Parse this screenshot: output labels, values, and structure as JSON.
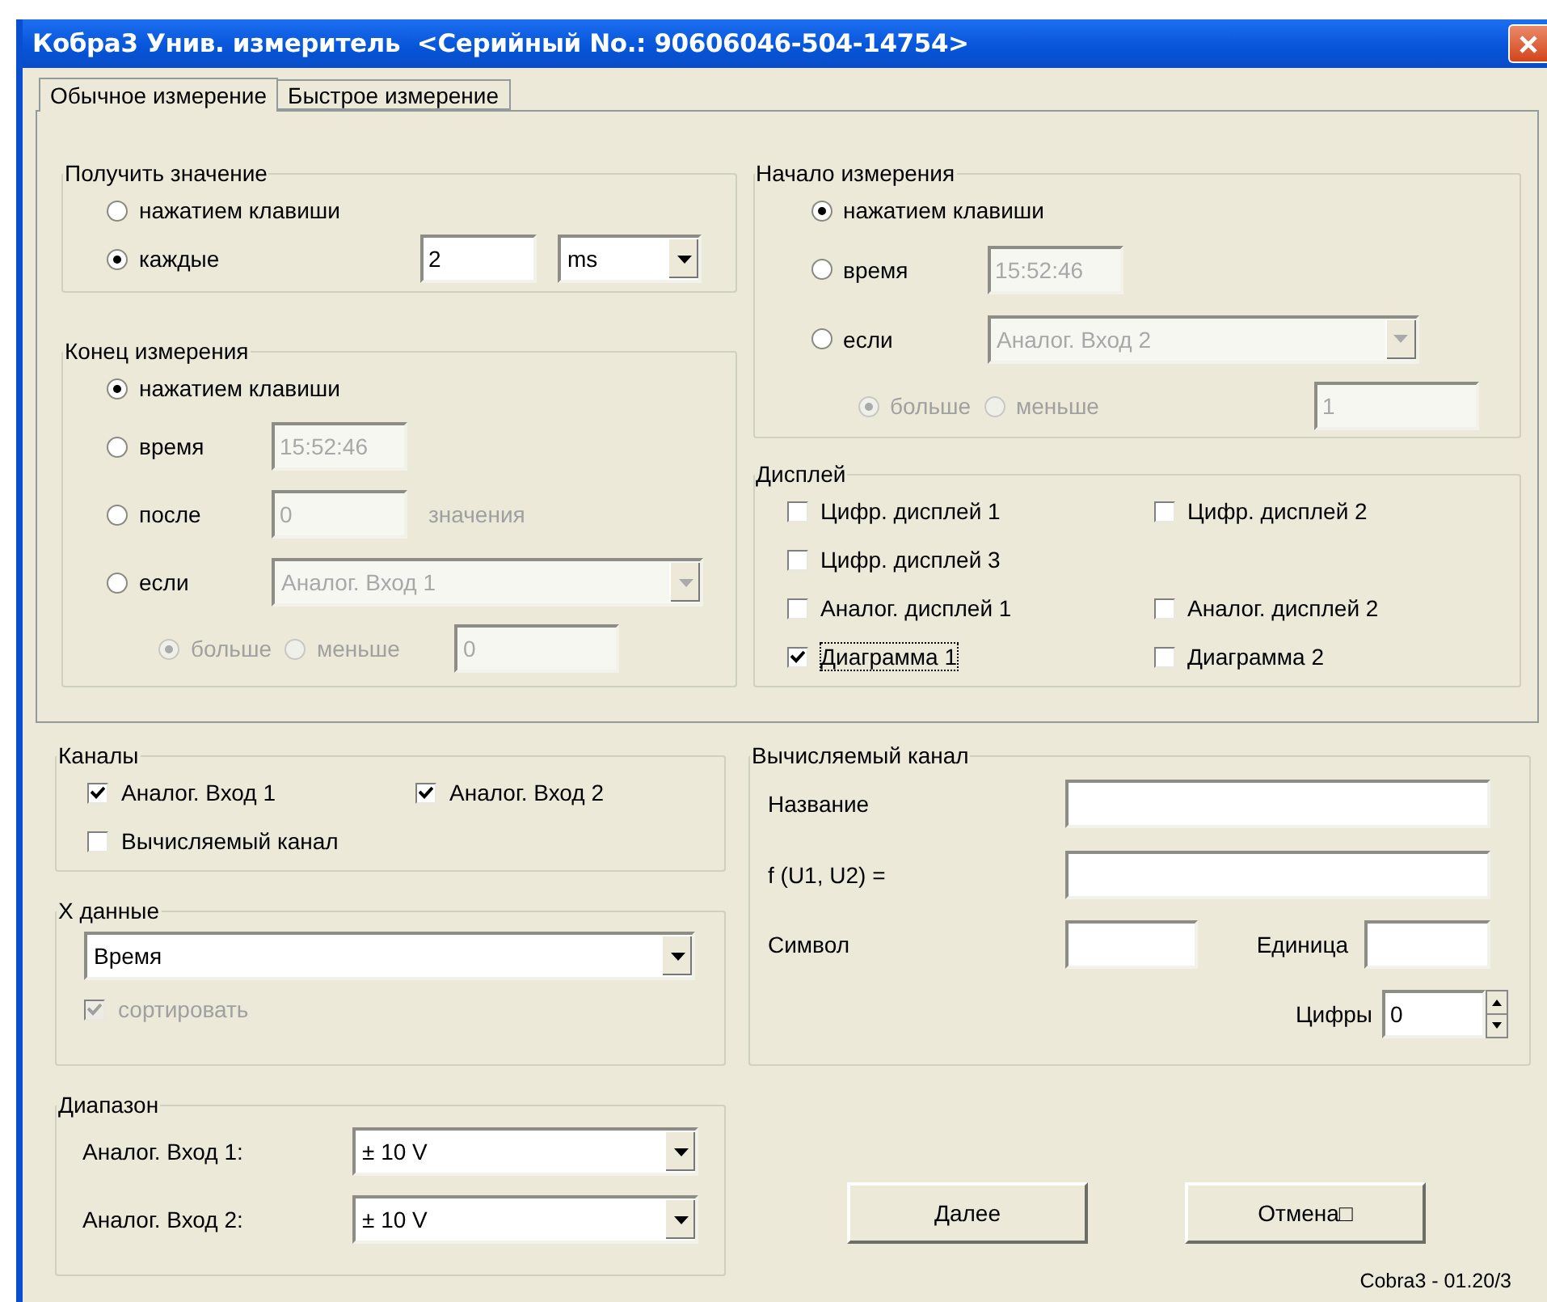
{
  "window": {
    "title": "Кобра3 Унив. измеритель  <Серийный No.: 90606046-504-14754>"
  },
  "tabs": [
    {
      "label": "Обычное измерение",
      "selected": true
    },
    {
      "label": "Быстрое измерение",
      "selected": false
    }
  ],
  "acquire": {
    "title": "Получить значение",
    "options": [
      {
        "kind": "plain",
        "label": "нажатием клавиши",
        "selected": false
      },
      {
        "kind": "interval",
        "label": "каждые",
        "selected": true,
        "value": "2",
        "unit": "ms"
      }
    ]
  },
  "end": {
    "title": "Конец измерения",
    "options": [
      {
        "kind": "plain",
        "label": "нажатием клавиши",
        "selected": true
      },
      {
        "kind": "time",
        "label": "время",
        "selected": false,
        "value": "15:52:46",
        "disabled": true
      },
      {
        "kind": "count",
        "label": "после",
        "selected": false,
        "value": "0",
        "suffix": "значения",
        "disabled": true
      },
      {
        "kind": "condition",
        "label": "если",
        "selected": false,
        "source": "Аналог. Вход 1",
        "disabled": true
      }
    ],
    "comparison": {
      "disabled": true,
      "threshold": "0",
      "options": [
        {
          "label": "больше",
          "selected": true
        },
        {
          "label": "меньше",
          "selected": false
        }
      ]
    }
  },
  "start": {
    "title": "Начало измерения",
    "options": [
      {
        "kind": "plain",
        "label": "нажатием клавиши",
        "selected": true
      },
      {
        "kind": "time",
        "label": "время",
        "selected": false,
        "value": "15:52:46",
        "disabled": true
      },
      {
        "kind": "condition",
        "label": "если",
        "selected": false,
        "source": "Аналог. Вход 2",
        "disabled": true
      }
    ],
    "comparison": {
      "disabled": true,
      "threshold": "1",
      "options": [
        {
          "label": "больше",
          "selected": true
        },
        {
          "label": "меньше",
          "selected": false
        }
      ]
    }
  },
  "display": {
    "title": "Дисплей",
    "rows": [
      [
        {
          "label": "Цифр. дисплей 1",
          "checked": false,
          "focused": false
        },
        {
          "label": "Цифр. дисплей 2",
          "checked": false,
          "focused": false
        }
      ],
      [
        {
          "label": "Цифр. дисплей 3",
          "checked": false,
          "focused": false
        }
      ],
      [
        {
          "label": "Аналог. дисплей 1",
          "checked": false,
          "focused": false
        },
        {
          "label": "Аналог. дисплей 2",
          "checked": false,
          "focused": false
        }
      ],
      [
        {
          "label": "Диаграмма 1",
          "checked": true,
          "focused": true
        },
        {
          "label": "Диаграмма 2",
          "checked": false,
          "focused": false
        }
      ]
    ]
  },
  "channels": {
    "title": "Каналы",
    "items": [
      {
        "label": "Аналог. Вход 1",
        "checked": true
      },
      {
        "label": "Аналог. Вход 2",
        "checked": true
      },
      {
        "label": "Вычисляемый канал",
        "checked": false
      }
    ]
  },
  "x_data": {
    "title": "X данные",
    "value": "Время",
    "sort": {
      "label": "сортировать",
      "checked": true,
      "disabled": true
    }
  },
  "range": {
    "title": "Диапазон",
    "rows": [
      {
        "label": "Аналог. Вход 1:",
        "value": "± 10 V"
      },
      {
        "label": "Аналог. Вход 2:",
        "value": "± 10 V"
      }
    ]
  },
  "computed": {
    "title": "Вычисляемый канал",
    "name_label": "Название",
    "formula_label": "f (U1, U2) =",
    "symbol_label": "Символ",
    "unit_label": "Единица",
    "digits_label": "Цифры",
    "digits_value": "0"
  },
  "buttons": [
    {
      "label": "Далее"
    },
    {
      "label": "Отмена□"
    }
  ],
  "footer": "Cobra3 - 01.20/3"
}
